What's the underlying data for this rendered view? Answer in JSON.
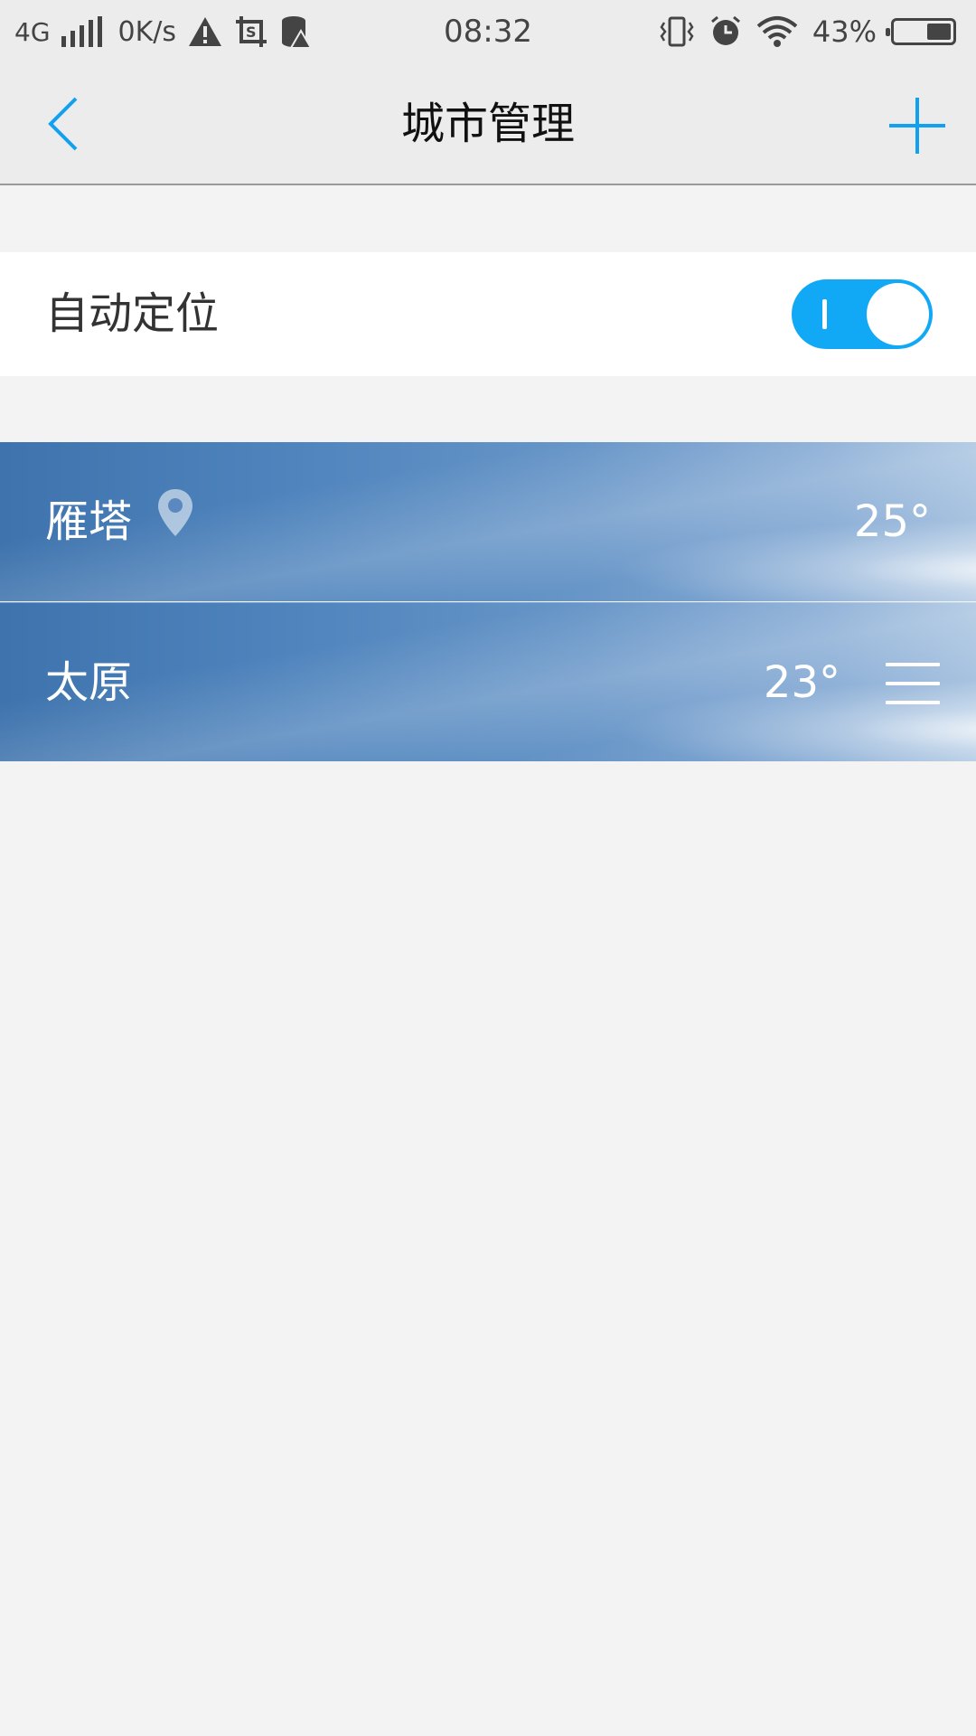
{
  "status_bar": {
    "network": "4G",
    "speed": "0K/s",
    "time": "08:32",
    "battery_percent": "43%",
    "battery_level": 0.43,
    "icons": [
      "signal-icon",
      "warning-icon",
      "screenshot-icon",
      "storage-warning-icon",
      "vibrate-icon",
      "alarm-icon",
      "wifi-icon",
      "battery-icon"
    ]
  },
  "header": {
    "title": "城市管理",
    "accent_color": "#11a1f0"
  },
  "auto_location": {
    "label": "自动定位",
    "enabled": true,
    "toggle_color": "#11a8f5"
  },
  "cities": [
    {
      "name": "雁塔",
      "temperature": "25°",
      "is_located": true
    },
    {
      "name": "太原",
      "temperature": "23°",
      "is_located": false
    }
  ]
}
